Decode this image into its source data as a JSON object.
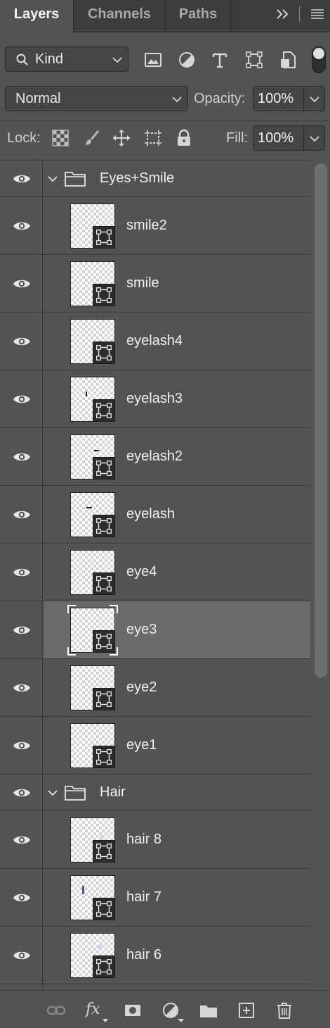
{
  "tabs": [
    {
      "label": "Layers",
      "active": true
    },
    {
      "label": "Channels",
      "active": false
    },
    {
      "label": "Paths",
      "active": false
    }
  ],
  "filter": {
    "kind_label": "Kind",
    "icons": [
      "image-filter-icon",
      "adjustment-filter-icon",
      "type-filter-icon",
      "shape-filter-icon",
      "smart-object-filter-icon"
    ]
  },
  "blend": {
    "mode": "Normal",
    "opacity_label": "Opacity:",
    "opacity_value": "100%"
  },
  "lock": {
    "label": "Lock:",
    "fill_label": "Fill:",
    "fill_value": "100%"
  },
  "layers": [
    {
      "type": "group",
      "name": "Eyes+Smile",
      "expanded": true
    },
    {
      "type": "layer",
      "name": "smile2",
      "mark": "none"
    },
    {
      "type": "layer",
      "name": "smile",
      "mark": "none"
    },
    {
      "type": "layer",
      "name": "eyelash4",
      "mark": "tiny-red"
    },
    {
      "type": "layer",
      "name": "eyelash3",
      "mark": "vline"
    },
    {
      "type": "layer",
      "name": "eyelash2",
      "mark": "hline"
    },
    {
      "type": "layer",
      "name": "eyelash",
      "mark": "hline2"
    },
    {
      "type": "layer",
      "name": "eye4",
      "mark": "none"
    },
    {
      "type": "layer",
      "name": "eye3",
      "mark": "none",
      "selected": true
    },
    {
      "type": "layer",
      "name": "eye2",
      "mark": "none"
    },
    {
      "type": "layer",
      "name": "eye1",
      "mark": "none"
    },
    {
      "type": "group",
      "name": "Hair",
      "expanded": true
    },
    {
      "type": "layer",
      "name": "hair 8",
      "mark": "blue-dot"
    },
    {
      "type": "layer",
      "name": "hair 7",
      "mark": "dark-vline"
    },
    {
      "type": "layer",
      "name": "hair 6",
      "mark": "blue-blob"
    }
  ],
  "toolbar": {
    "fx_label": "fx",
    "icons": [
      "link-layers-icon",
      "fx-icon",
      "layer-mask-icon",
      "adjustment-layer-icon",
      "new-group-icon",
      "new-layer-icon",
      "trash-icon"
    ]
  },
  "colors": {
    "panel_bg": "#535353",
    "tab_bar_bg": "#3d3d3d",
    "selected_row_bg": "#6a6a6a",
    "border": "#3a3a3a"
  }
}
